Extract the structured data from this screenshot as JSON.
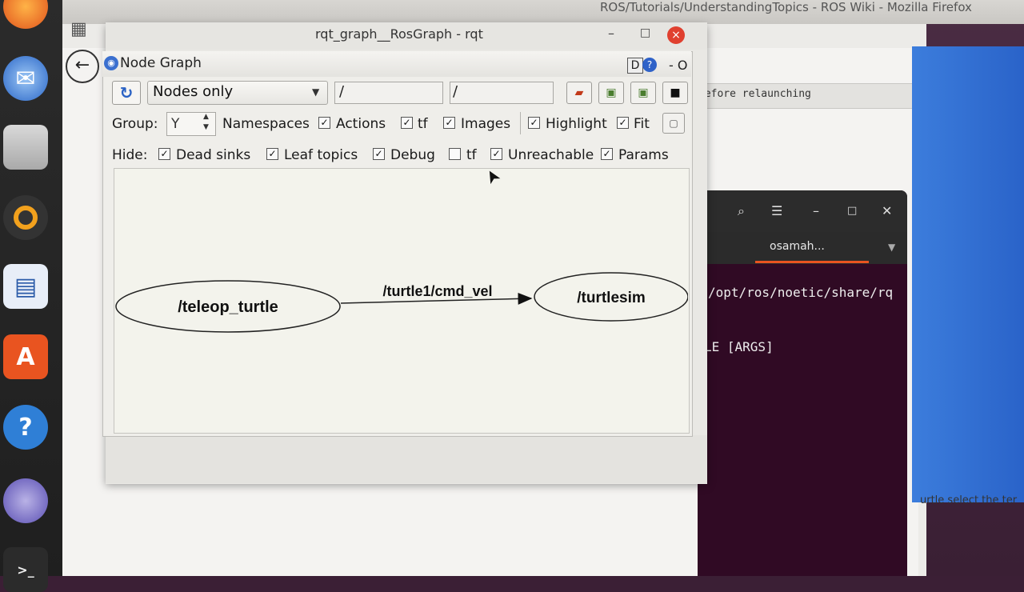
{
  "browser": {
    "title": "ROS/Tutorials/UnderstandingTopics - ROS Wiki - Mozilla Firefox",
    "banner_text": "before relaunching",
    "bottom_text": "urtle select the ter"
  },
  "terminal": {
    "tab_label": "osamah...",
    "line1": "/opt/ros/noetic/share/rq",
    "line2": "LE [ARGS]"
  },
  "rqt": {
    "title": "rqt_graph__RosGraph - rqt",
    "minimize": "–",
    "maximize": "□",
    "close": "×"
  },
  "node_graph": {
    "title": "Node Graph",
    "d_label": "D",
    "help_label": "?",
    "dash_o": "- O",
    "combo_value": "Nodes only",
    "filter1": "/",
    "filter2": "/",
    "group_label": "Group:",
    "group_value": "Y",
    "group_row": [
      {
        "label": "Namespaces",
        "checked": true
      },
      {
        "label": "Actions",
        "checked": true
      },
      {
        "label": "tf",
        "checked": true
      },
      {
        "label": "Images",
        "checked": true
      },
      {
        "label": "Highlight",
        "checked": true
      },
      {
        "label": "Fit",
        "checked": true
      }
    ],
    "hide_label": "Hide:",
    "hide_row": [
      {
        "label": "Dead sinks",
        "checked": true
      },
      {
        "label": "Leaf topics",
        "checked": true
      },
      {
        "label": "Debug",
        "checked": true
      },
      {
        "label": "tf",
        "checked": false
      },
      {
        "label": "Unreachable",
        "checked": true
      },
      {
        "label": "Params",
        "checked": true
      }
    ]
  },
  "graph": {
    "nodes": [
      "/teleop_turtle",
      "/turtlesim"
    ],
    "edges": [
      {
        "from": "/teleop_turtle",
        "to": "/turtlesim",
        "label": "/turtle1/cmd_vel"
      }
    ]
  },
  "colors": {
    "rqt_close": "#e0402f",
    "accent_blue": "#2f62c8",
    "terminal_bg": "#300a24",
    "ubuntu_orange": "#e95420"
  },
  "icons": {
    "dock": [
      "firefox-icon",
      "thunderbird-icon",
      "files-icon",
      "rhythmbox-icon",
      "libreoffice-impress-icon",
      "software-center-icon",
      "help-icon",
      "disc-icon",
      "terminal-icon"
    ]
  }
}
